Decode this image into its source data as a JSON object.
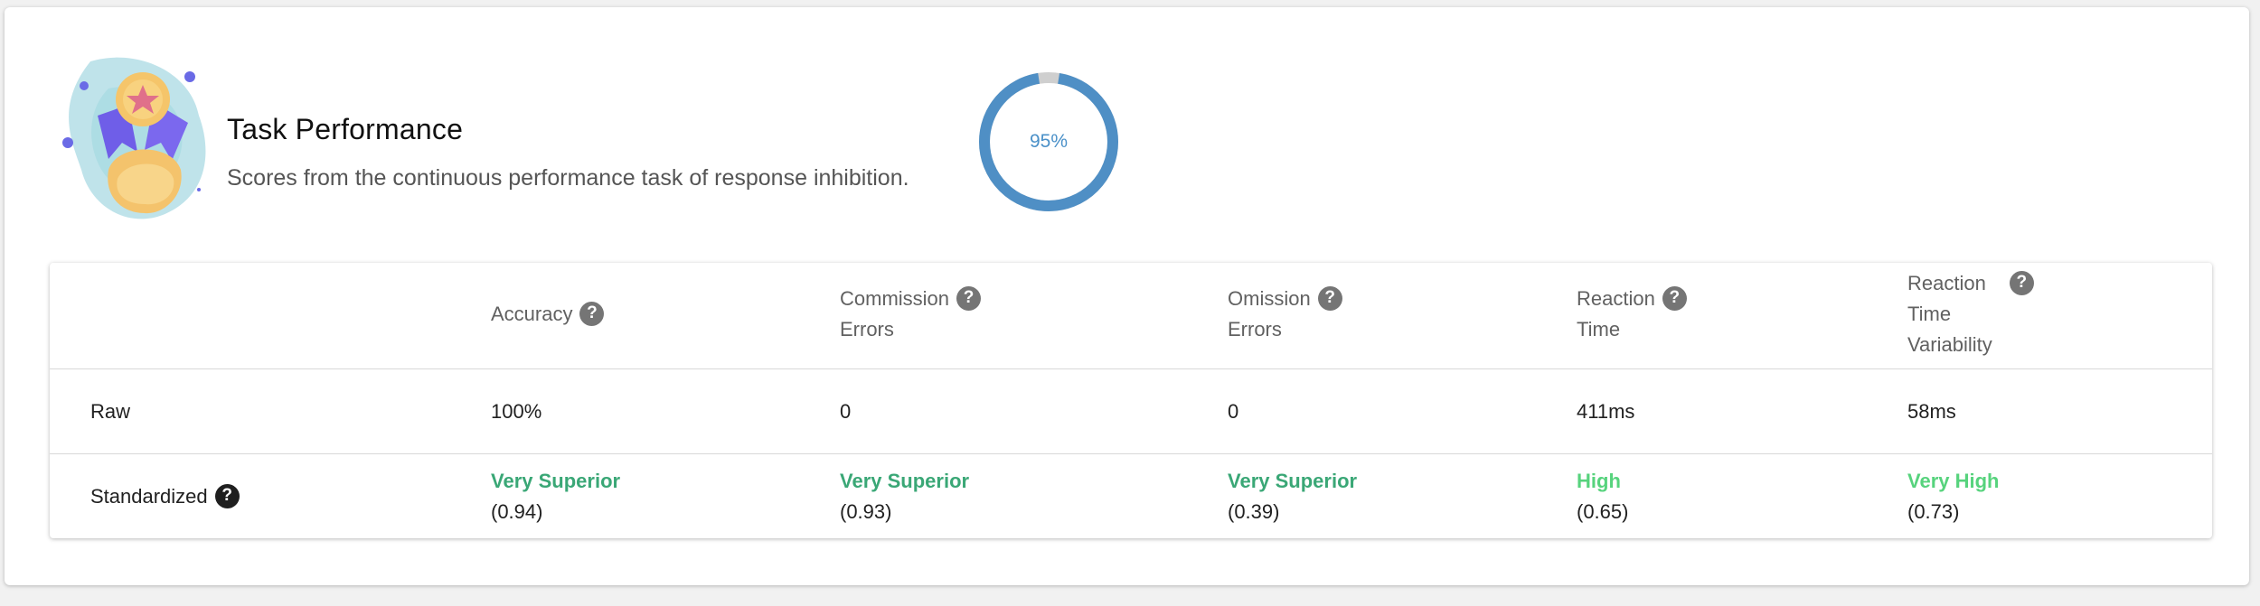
{
  "header": {
    "title": "Task Performance",
    "subtitle": "Scores from the continuous performance task of response inhibition.",
    "progress": {
      "value": 0.95,
      "label": "95%"
    }
  },
  "colors": {
    "gauge": "#4f8fc5",
    "gauge_track": "#cfcfcf",
    "very_superior": "#3aa776",
    "high": "#57d37d"
  },
  "table": {
    "columns": [
      {
        "line1": "Accuracy",
        "line2": "",
        "line3": ""
      },
      {
        "line1": "Commission",
        "line2": "Errors",
        "line3": ""
      },
      {
        "line1": "Omission",
        "line2": "Errors",
        "line3": ""
      },
      {
        "line1": "Reaction",
        "line2": "Time",
        "line3": ""
      },
      {
        "line1": "Reaction",
        "line2": "Time",
        "line3": "Variability"
      }
    ],
    "raw": {
      "label": "Raw",
      "values": [
        "100%",
        "0",
        "0",
        "411ms",
        "58ms"
      ]
    },
    "standardized": {
      "label": "Standardized",
      "values": [
        {
          "rating": "Very Superior",
          "score": "(0.94)",
          "color": "#3aa776"
        },
        {
          "rating": "Very Superior",
          "score": "(0.93)",
          "color": "#3aa776"
        },
        {
          "rating": "Very Superior",
          "score": "(0.39)",
          "color": "#3aa776"
        },
        {
          "rating": "High",
          "score": "(0.65)",
          "color": "#57d37d"
        },
        {
          "rating": "Very High",
          "score": "(0.73)",
          "color": "#57d37d"
        }
      ]
    }
  }
}
